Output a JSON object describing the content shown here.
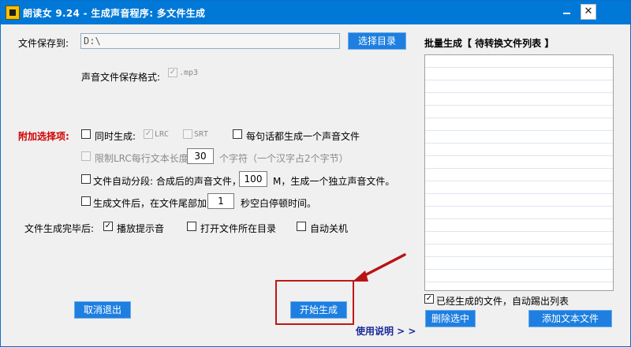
{
  "window": {
    "title": "朗读女 9.24 - 生成声音程序: 多文件生成",
    "close_glyph": "✕"
  },
  "save": {
    "label": "文件保存到:",
    "path_value": "D:\\",
    "choose_dir_button": "选择目录",
    "format_label": "声音文件保存格式:",
    "format_option": ".mp3",
    "format_checked": true
  },
  "extra": {
    "label": "附加选择项:",
    "sync_label": "同时生成:",
    "lrc_label": "LRC",
    "srt_label": "SRT",
    "each_sentence_label": "每句话都生成一个声音文件",
    "limit_lrc_label": "限制LRC每行文本长度:",
    "limit_lrc_value": "30",
    "limit_lrc_suffix": "个字符（一个汉字占2个字节）",
    "auto_split_label": "文件自动分段: 合成后的声音文件，每",
    "auto_split_value": "100",
    "auto_split_suffix": "M，生成一个独立声音文件。",
    "append_silence_label": "生成文件后，在文件尾部加入",
    "append_silence_value": "1",
    "append_silence_suffix": "秒空白停顿时间。"
  },
  "completion": {
    "label": "文件生成完毕后:",
    "play_sound": "播放提示音",
    "open_folder": "打开文件所在目录",
    "shutdown": "自动关机"
  },
  "buttons": {
    "cancel": "取消退出",
    "start": "开始生成",
    "help": "使用说明 > >",
    "delete_selected": "删除选中",
    "add_text_file": "添加文本文件"
  },
  "batch": {
    "title": "批量生成【 待转换文件列表 】",
    "remove_done": "已经生成的文件，自动踢出列表",
    "remove_done_checked": true
  },
  "checkmark": "✓"
}
